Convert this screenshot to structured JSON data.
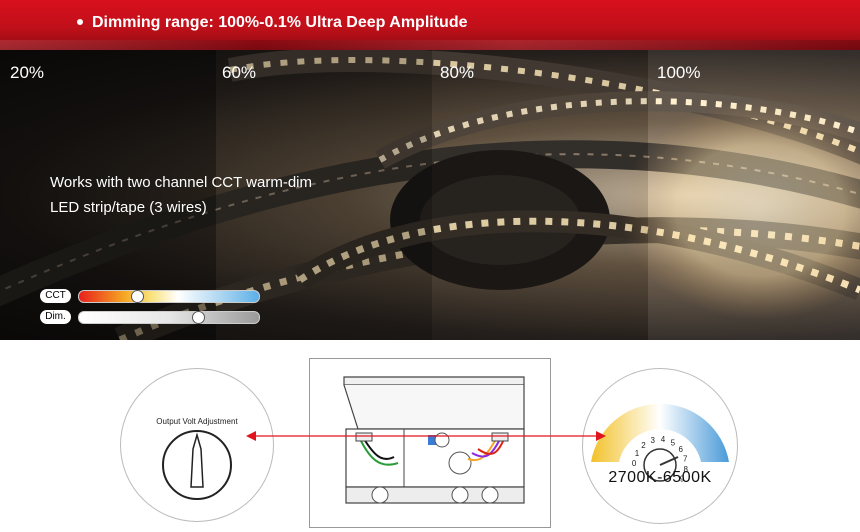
{
  "banner": {
    "text": "Dimming range: 100%-0.1% Ultra Deep Amplitude"
  },
  "photo": {
    "levels": [
      "20%",
      "60%",
      "80%",
      "100%"
    ],
    "caption_line1": "Works with two channel CCT warm-dim",
    "caption_line2": "LED strip/tape (3 wires)",
    "sliders": [
      {
        "label": "CCT",
        "level": 0.32
      },
      {
        "label": "Dim.",
        "level": 0.66
      }
    ]
  },
  "diagram": {
    "left_dial_label": "Output Volt Adjustment",
    "right_dial_label": "2700K-6500K",
    "right_dial_ticks": [
      "0",
      "1",
      "2",
      "3",
      "4",
      "5",
      "6",
      "7",
      "8",
      "9"
    ],
    "colors": {
      "arrow": "#e0141e",
      "warm": "#f2c22a",
      "cool": "#4a9ad8"
    }
  }
}
